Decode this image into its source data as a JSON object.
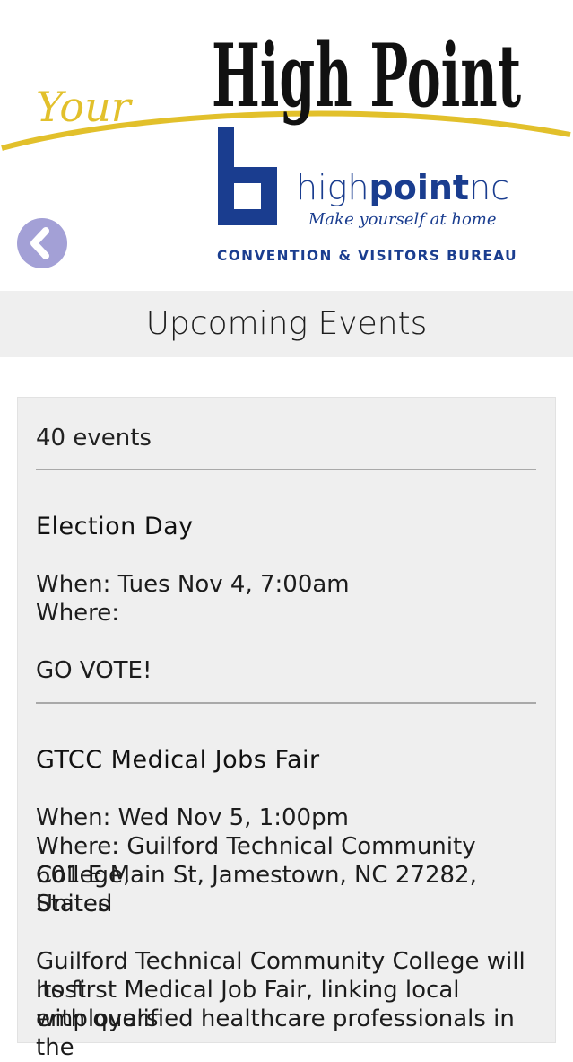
{
  "header": {
    "logo_top": "High Point",
    "logo_script": "Your",
    "brand_light": "high",
    "brand_bold": "point",
    "brand_suffix": "nc",
    "tagline": "Make yourself at home",
    "bureau": "CONVENTION & VISITORS BUREAU",
    "brand_color": "#1a3d8f",
    "swoosh_color": "#e2c02b"
  },
  "nav": {
    "back_icon": "chevron-left-icon",
    "back_color": "#a3a0d6"
  },
  "page": {
    "title": "Upcoming Events"
  },
  "events": {
    "count_label": "40 events",
    "items": [
      {
        "title": "Election Day",
        "when": "When: Tues Nov 4, 7:00am",
        "where": "Where:",
        "description": "GO VOTE!"
      },
      {
        "title": "GTCC Medical Jobs Fair",
        "when": "When: Wed Nov 5, 1:00pm",
        "where_1": "Where: Guilford Technical Community College,",
        "where_2": "601 E Main St, Jamestown, NC 27282, United",
        "where_3": "States",
        "desc_1": "Guilford Technical Community College will host",
        "desc_2": "its first Medical Job Fair, linking local employers",
        "desc_3": "with qualified healthcare professionals in the"
      }
    ]
  }
}
